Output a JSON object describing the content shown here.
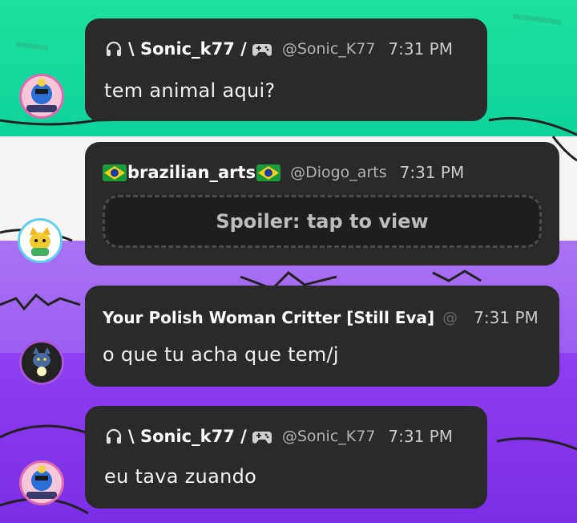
{
  "messages": [
    {
      "id": "m1",
      "author": "\\ Sonic_k77 /",
      "handle": "@Sonic_K77",
      "time": "7:31 PM",
      "text": "tem animal aqui?",
      "avatar_label": "SONIC_K77",
      "left_icon": "headphones-icon",
      "right_icon": "gamepad-icon"
    },
    {
      "id": "m2",
      "author": "brazilian_arts",
      "handle": "@Diogo_arts",
      "time": "7:31 PM",
      "spoiler_label": "Spoiler: tap to view",
      "left_icon": "brazil-flag-icon",
      "right_icon": "brazil-flag-icon"
    },
    {
      "id": "m3",
      "author": "Your Polish Woman Critter [Still Eva]",
      "handle": "@",
      "time": "7:31 PM",
      "text": "o que tu acha que tem/j"
    },
    {
      "id": "m4",
      "author": "\\ Sonic_k77 /",
      "handle": "@Sonic_K77",
      "time": "7:31 PM",
      "text": "eu tava zuando",
      "avatar_label": "SONIC_K77",
      "left_icon": "headphones-icon",
      "right_icon": "gamepad-icon"
    }
  ],
  "colors": {
    "bubble": "#2b2a2b",
    "green_bg": "#1ee0a0",
    "purple_bg": "#9a5ff0",
    "white_bg": "#f6f4f4"
  }
}
